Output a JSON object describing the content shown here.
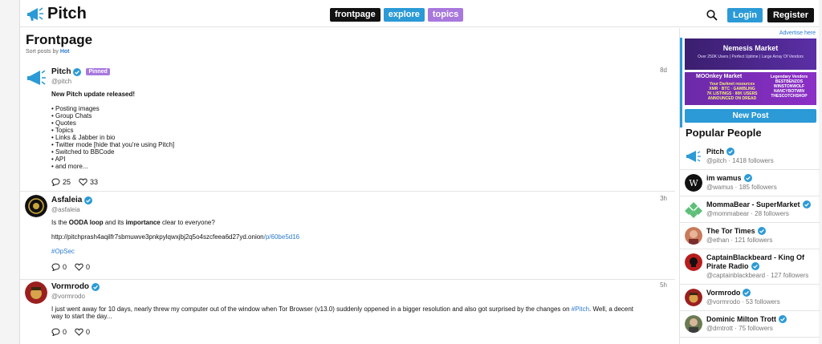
{
  "header": {
    "logo_text": "Pitch",
    "tabs": [
      {
        "label": "frontpage"
      },
      {
        "label": "explore"
      },
      {
        "label": "topics"
      }
    ],
    "login_label": "Login",
    "register_label": "Register"
  },
  "feed": {
    "title": "Frontpage",
    "sort_prefix": "Sort posts by",
    "sort_value": "Hot",
    "posts": [
      {
        "author": "Pitch",
        "handle": "@pitch",
        "badge": "Pinned",
        "time": "8d",
        "headline": "New Pitch update released!",
        "bullets": [
          "• Posting images",
          "• Group Chats",
          "• Quotes",
          "• Topics",
          "• Links & Jabber in bio",
          "• Twitter mode [hide that you're using Pitch]",
          "• Switched to BBCode",
          "• API",
          "• and more..."
        ],
        "comments": "25",
        "likes": "33"
      },
      {
        "author": "Asfaleia",
        "handle": "@asfaleia",
        "time": "3h",
        "line1_a": "Is the ",
        "line1_b": "OODA loop",
        "line1_c": " and its ",
        "line1_d": "importance",
        "line1_e": " clear to everyone?",
        "url_base": "http://pitchprash4aqilfr7sbmuwve3pnkpylqwxjbj2q5o4szcfeea6d27yd.onion",
        "url_path": "/p/60be5d16",
        "tag": "#OpSec",
        "comments": "0",
        "likes": "0"
      },
      {
        "author": "Vormrodo",
        "handle": "@vormrodo",
        "time": "5h",
        "text_a": "I just went away for 10 days, nearly threw my computer out of the window when Tor Browser (v13.0) suddenly oppened in a bigger resolution and also got surprised by the changes on ",
        "text_tag": "#Pitch",
        "text_b": ". Well, a decent way to start the day...",
        "comments": "0",
        "likes": "0"
      }
    ]
  },
  "sidebar": {
    "ad_link": "Advertise here",
    "banner1": {
      "title": "Nemesis Market",
      "subtitle": "Over 250K Users | Perfect Uptime | Large Array Of Vendors"
    },
    "banner2": {
      "title": "MOOnkey Market",
      "left_lines": "Your Darknet resources\nXMR · BTC · GAMBLING\n7K LISTINGS · 80K USERS\nANNOUNCED ON DREAD",
      "right_lines": "Legendary Vendors\nBESTBENZOS\nWINSTONWOLF\nNANCYBOTWIN\nTHESCOTCHSHOP"
    },
    "new_post_label": "New Post",
    "popular_title": "Popular People",
    "people": [
      {
        "name": "Pitch",
        "meta": "@pitch · 1418 followers"
      },
      {
        "name": "im wamus",
        "meta": "@wamus · 185 followers"
      },
      {
        "name": "MommaBear - SuperMarket",
        "meta": "@mommabear · 28 followers"
      },
      {
        "name": "The Tor Times",
        "meta": "@ethan · 121 followers"
      },
      {
        "name": "CaptainBlackbeard - King Of",
        "name2": "Pirate Radio",
        "meta": "@captainblackbeard · 127 followers"
      },
      {
        "name": "Vormrodo",
        "meta": "@vormrodo · 53 followers"
      },
      {
        "name": "Dominic Milton Trott",
        "meta": "@dmtrott · 75 followers"
      }
    ]
  },
  "colors": {
    "accent_blue": "#2b9ad6",
    "accent_purple": "#a878dd",
    "dark": "#111111"
  }
}
